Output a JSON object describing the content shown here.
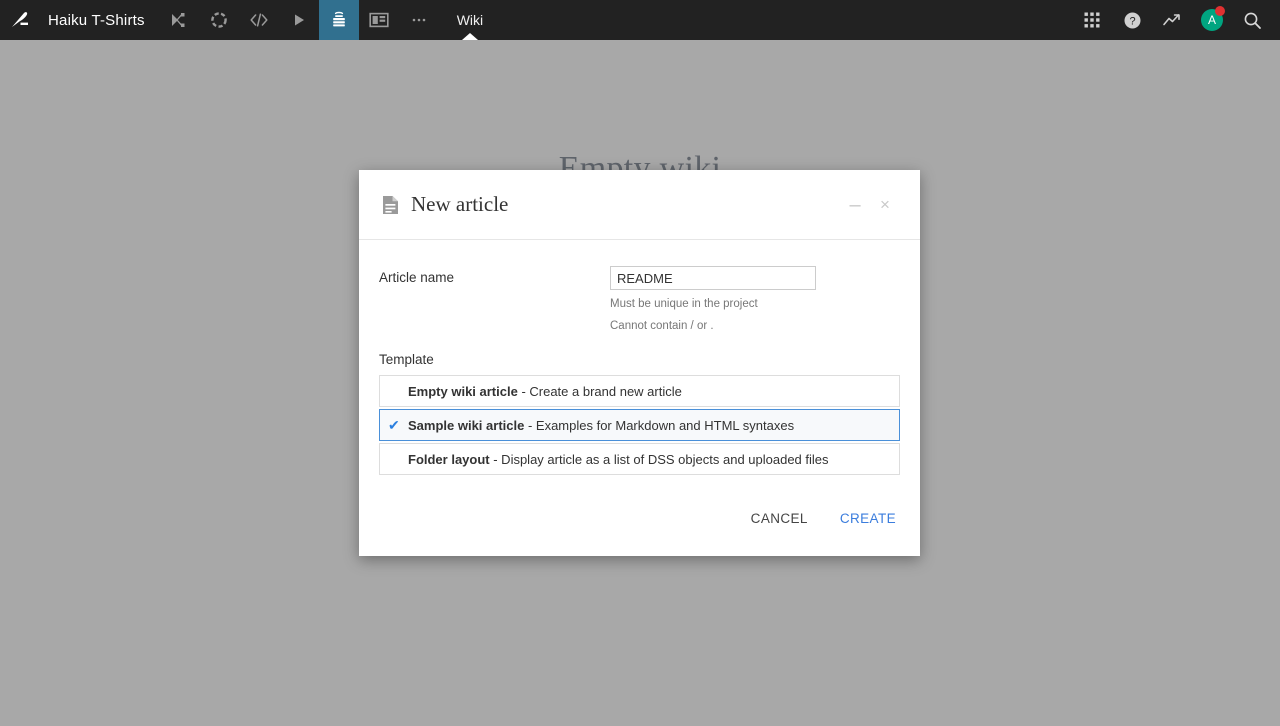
{
  "topnav": {
    "logo_icon": "dataiku-logo-icon",
    "project_name": "Haiku T-Shirts",
    "icons": [
      {
        "name": "flow-icon",
        "title": "Flow"
      },
      {
        "name": "recipes-icon",
        "title": "Recipes"
      },
      {
        "name": "code-icon",
        "title": "Code"
      },
      {
        "name": "jobs-icon",
        "title": "Jobs"
      },
      {
        "name": "wiki-icon",
        "title": "Wiki",
        "active": true
      },
      {
        "name": "dashboard-icon",
        "title": "Dashboards"
      },
      {
        "name": "more-icon",
        "title": "More"
      }
    ],
    "active_tab": "Wiki",
    "right_icons": [
      {
        "name": "apps-grid-icon",
        "title": "Apps"
      },
      {
        "name": "help-icon",
        "title": "Help"
      },
      {
        "name": "activity-icon",
        "title": "Activity"
      }
    ],
    "avatar_initial": "A",
    "search_icon": "search-icon"
  },
  "background": {
    "heading": "Empty wiki"
  },
  "dialog": {
    "icon": "article-icon",
    "title": "New article",
    "minimize_label": "–",
    "close_label": "×",
    "article_name": {
      "label": "Article name",
      "value": "README",
      "placeholder": "",
      "hints": [
        "Must be unique in the project",
        "Cannot contain / or ."
      ]
    },
    "template": {
      "label": "Template",
      "options": [
        {
          "name": "Empty wiki article",
          "description": " - Create a brand new article",
          "selected": false
        },
        {
          "name": "Sample wiki article",
          "description": " - Examples for Markdown and HTML syntaxes",
          "selected": true
        },
        {
          "name": "Folder layout",
          "description": " - Display article as a list of DSS objects and uploaded files",
          "selected": false
        }
      ],
      "check_glyph": "✔"
    },
    "footer": {
      "cancel_label": "CANCEL",
      "create_label": "CREATE"
    }
  },
  "colors": {
    "nav_bg": "#222222",
    "nav_active": "#31708f",
    "backdrop": "#a8a8a8",
    "accent_blue": "#3b7ddd",
    "selected_border": "#4a90d9",
    "avatar_green": "#00a580",
    "badge_red": "#e03131"
  }
}
